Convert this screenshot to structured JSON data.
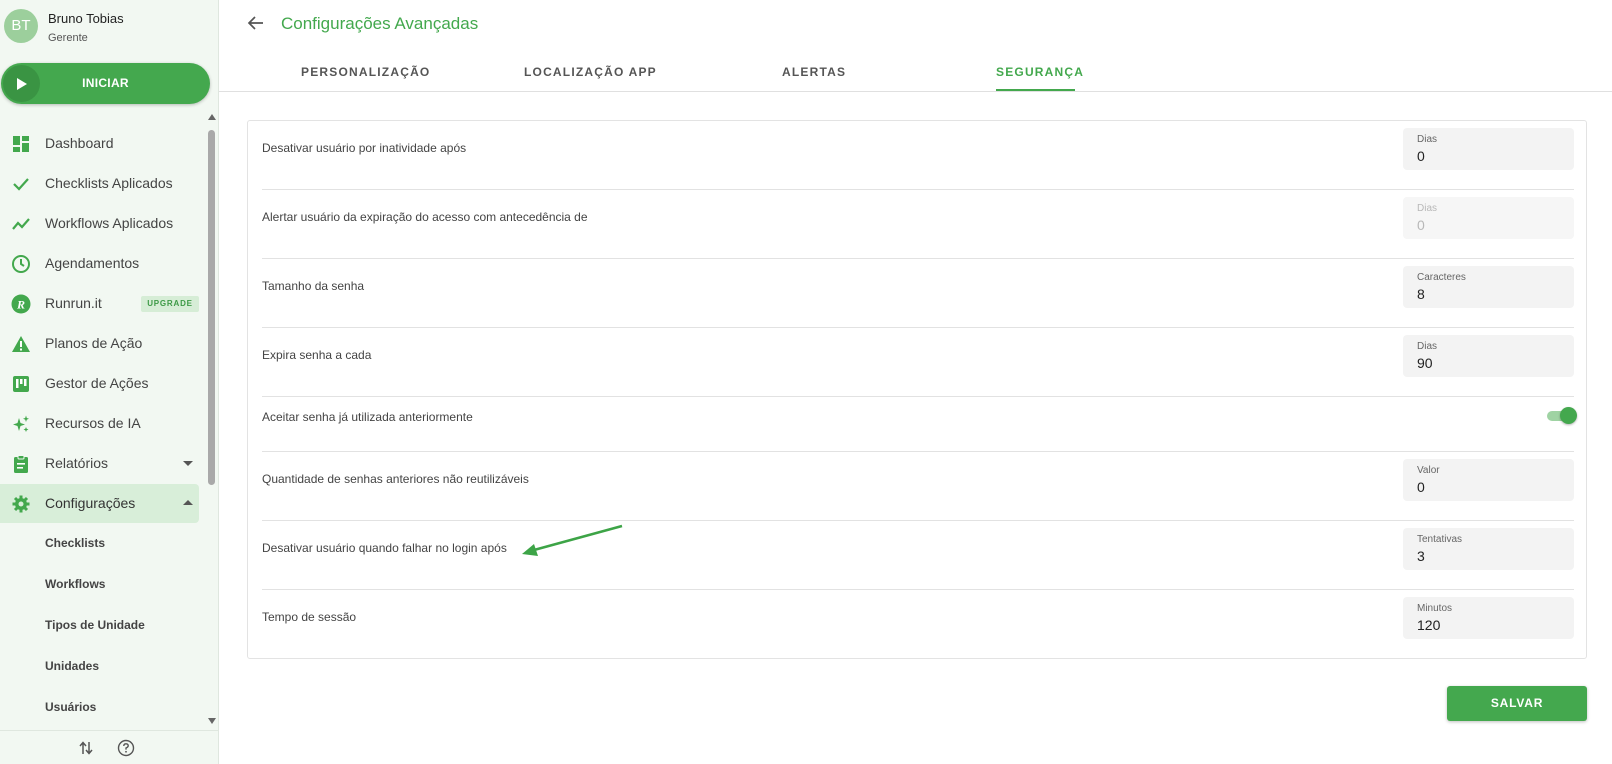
{
  "user": {
    "initials": "BT",
    "name": "Bruno Tobias",
    "role": "Gerente"
  },
  "start_button": {
    "label": "INICIAR"
  },
  "nav": {
    "items": [
      {
        "label": "Dashboard",
        "icon": "dashboard-icon"
      },
      {
        "label": "Checklists Aplicados",
        "icon": "check-icon"
      },
      {
        "label": "Workflows Aplicados",
        "icon": "trending-icon"
      },
      {
        "label": "Agendamentos",
        "icon": "clock-icon"
      },
      {
        "label": "Runrun.it",
        "icon": "runrun-logo-icon",
        "badge": "UPGRADE"
      },
      {
        "label": "Planos de Ação",
        "icon": "warning-icon"
      },
      {
        "label": "Gestor de Ações",
        "icon": "kanban-icon"
      },
      {
        "label": "Recursos de IA",
        "icon": "sparkles-icon"
      },
      {
        "label": "Relatórios",
        "icon": "clipboard-icon"
      },
      {
        "label": "Configurações",
        "icon": "gear-icon"
      }
    ],
    "sub_items": [
      "Checklists",
      "Workflows",
      "Tipos de Unidade",
      "Unidades",
      "Usuários"
    ]
  },
  "header": {
    "title": "Configurações Avançadas"
  },
  "tabs": [
    {
      "label": "PERSONALIZAÇÃO"
    },
    {
      "label": "LOCALIZAÇÃO APP"
    },
    {
      "label": "ALERTAS"
    },
    {
      "label": "SEGURANÇA",
      "active": true
    }
  ],
  "settings": [
    {
      "label": "Desativar usuário por inatividade após",
      "caption": "Dias",
      "value": "0"
    },
    {
      "label": "Alertar usuário da expiração do acesso com antecedência de",
      "caption": "Dias",
      "value": "0",
      "disabled": true
    },
    {
      "label": "Tamanho da senha",
      "caption": "Caracteres",
      "value": "8"
    },
    {
      "label": "Expira senha a cada",
      "caption": "Dias",
      "value": "90"
    },
    {
      "label": "Aceitar senha já utilizada anteriormente",
      "toggle": true
    },
    {
      "label": "Quantidade de senhas anteriores não reutilizáveis",
      "caption": "Valor",
      "value": "0"
    },
    {
      "label": "Desativar usuário quando falhar no login após",
      "caption": "Tentativas",
      "value": "3"
    },
    {
      "label": "Tempo de sessão",
      "caption": "Minutos",
      "value": "120"
    }
  ],
  "save_button": {
    "label": "SALVAR"
  },
  "colors": {
    "accent": "#43a84d",
    "sidebar_bg": "#f2f8f2",
    "active_nav_bg": "#d8eed9"
  }
}
